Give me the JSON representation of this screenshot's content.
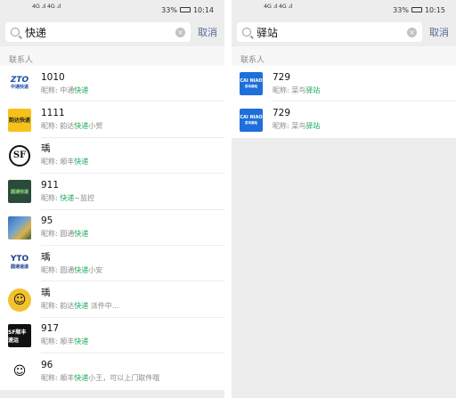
{
  "left": {
    "status": {
      "signal": "4G .ıl 4G .ıl",
      "battery": "33%",
      "time": "10:14"
    },
    "search": {
      "query": "快递",
      "cancel_label": "取消"
    },
    "section_title": "联系人",
    "items": [
      {
        "name": "1010",
        "nick_prefix": "昵称: 中通",
        "nick_hl": "快递",
        "nick_suffix": "",
        "avatar": "ZTO",
        "avatar_sub": "中通快递"
      },
      {
        "name": "1111",
        "nick_prefix": "昵称: 韵达",
        "nick_hl": "快递",
        "nick_suffix": "小贺",
        "avatar": "韵达快递",
        "avatar_sub": ""
      },
      {
        "name": "瑀",
        "nick_prefix": "昵称: 顺丰",
        "nick_hl": "快递",
        "nick_suffix": "",
        "avatar": "SF",
        "avatar_sub": ""
      },
      {
        "name": "911",
        "nick_prefix": "昵称: ",
        "nick_hl": "快递",
        "nick_suffix": "~监控",
        "avatar": "圆通快递",
        "avatar_sub": ""
      },
      {
        "name": "95",
        "nick_prefix": "昵称: 圆通",
        "nick_hl": "快递",
        "nick_suffix": "",
        "avatar": "",
        "avatar_sub": ""
      },
      {
        "name": "瑀",
        "nick_prefix": "昵称: 圆通",
        "nick_hl": "快递",
        "nick_suffix": "小安",
        "avatar": "YTO",
        "avatar_sub": "圆通速递"
      },
      {
        "name": "瑀",
        "nick_prefix": "昵称: 韵达",
        "nick_hl": "快递",
        "nick_suffix": "  派件中...",
        "avatar": "☺",
        "avatar_sub": ""
      },
      {
        "name": "917",
        "nick_prefix": "昵称: 顺丰",
        "nick_hl": "快递",
        "nick_suffix": "",
        "avatar": "SF顺丰速运",
        "avatar_sub": ""
      },
      {
        "name": "96",
        "nick_prefix": "昵称: 顺丰",
        "nick_hl": "快递",
        "nick_suffix": "小王，可以上门取件哦",
        "avatar": "☺",
        "avatar_sub": ""
      }
    ]
  },
  "right": {
    "status": {
      "signal": "4G .ıl 4G .ıl",
      "battery": "33%",
      "time": "10:15"
    },
    "search": {
      "query": "驿站",
      "cancel_label": "取消"
    },
    "section_title": "联系人",
    "items": [
      {
        "name": "729",
        "nick_prefix": "昵称: 菜鸟",
        "nick_hl": "驿站",
        "nick_suffix": "",
        "avatar": "CAI NIAO",
        "avatar_sub": "菜鸟驿站"
      },
      {
        "name": "729",
        "nick_prefix": "昵称: 菜鸟",
        "nick_hl": "驿站",
        "nick_suffix": "",
        "avatar": "CAI NIAO",
        "avatar_sub": "菜鸟驿站"
      }
    ]
  },
  "colors": {
    "highlight": "#19a85a",
    "cancel": "#586b94",
    "background": "#ededed"
  }
}
